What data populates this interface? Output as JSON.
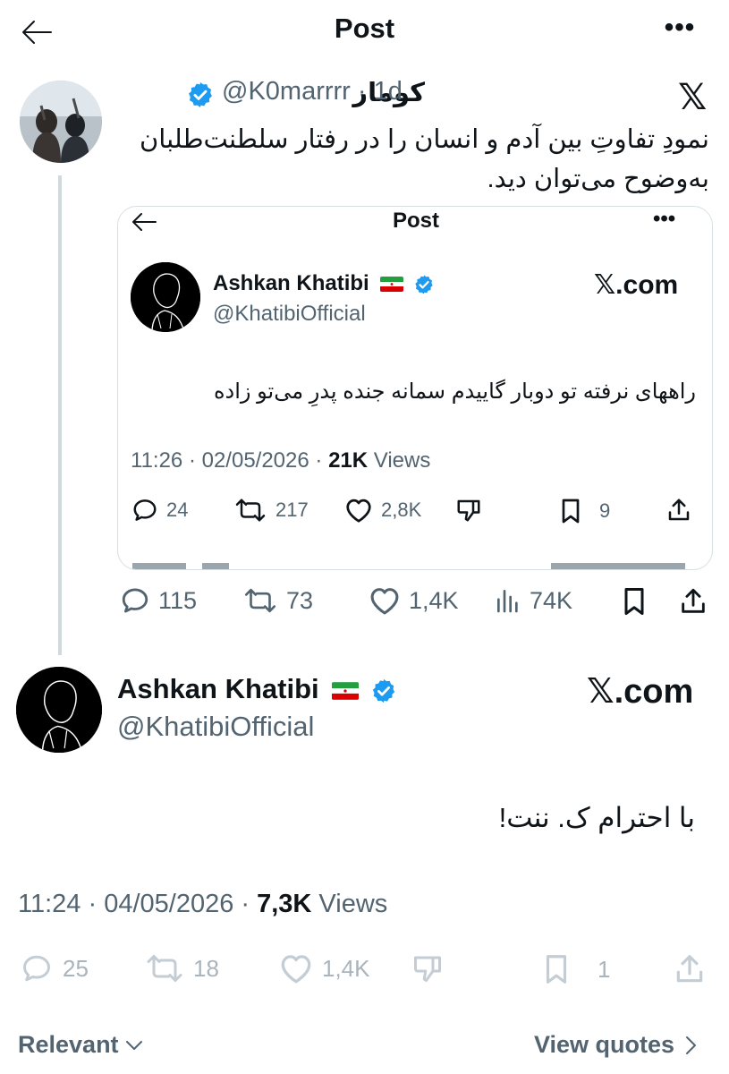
{
  "header": {
    "title": "Post",
    "more": "•••"
  },
  "quote_tweet": {
    "author": "کومار",
    "handle": "@K0marrrr",
    "age": "· 1d",
    "watermark": "𝕏",
    "text_line1": "نمودِ تفاوتِ بین آدم و انسان را در رفتار سلطنت‌طلبان",
    "text_line2": "به‌وضوح می‌توان دید.",
    "actions": {
      "replies": "115",
      "reposts": "73",
      "likes": "1,4K",
      "views": "74K"
    }
  },
  "embedded": {
    "title": "Post",
    "more": "•••",
    "author": "Ashkan Khatibi",
    "handle": "@KhatibiOfficial",
    "watermark": "𝕏.com",
    "text": "راههای نرفته تو دوبار گاییدم سمانه جنده پدرِ می‌تو زاده",
    "timestamp": "11:26 · 02/05/2026 · ",
    "views_count": "21K",
    "views_label": " Views",
    "actions": {
      "replies": "24",
      "reposts": "217",
      "likes": "2,8K",
      "bookmarks": "9"
    }
  },
  "reply_tweet": {
    "author": "Ashkan Khatibi",
    "handle": "@KhatibiOfficial",
    "watermark": "𝕏.com",
    "text": "با احترام ک. ننت!",
    "timestamp": "11:24 · 04/05/2026 · ",
    "views_count": "7,3K",
    "views_label": " Views",
    "actions": {
      "replies": "25",
      "reposts": "18",
      "likes": "1,4K",
      "bookmarks": "1"
    }
  },
  "footer": {
    "sort_label": "Relevant",
    "view_quotes": "View quotes"
  },
  "colors": {
    "text": "#0f1419",
    "muted": "#536471",
    "verified": "#1d9bf0",
    "border": "#cfd9de"
  }
}
